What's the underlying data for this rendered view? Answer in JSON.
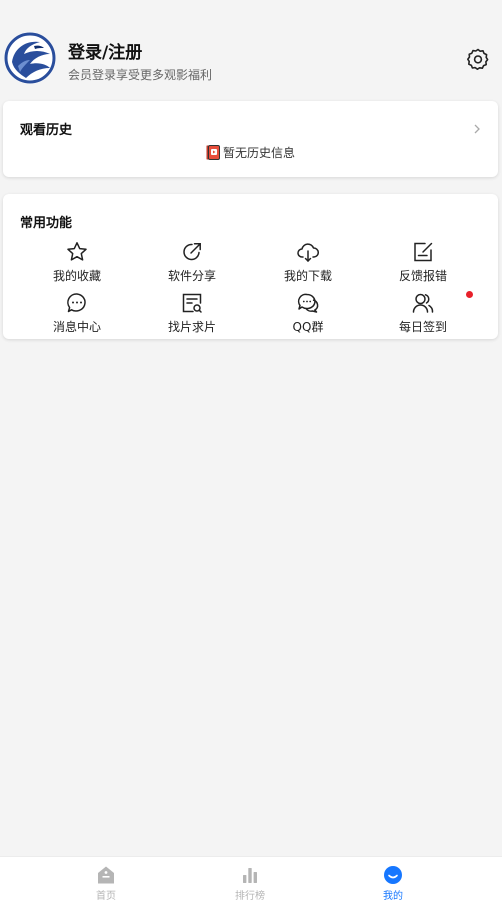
{
  "header": {
    "title": "登录/注册",
    "subtitle": "会员登录享受更多观影福利",
    "avatar_icon": "eagle-logo",
    "settings_icon": "gear-icon"
  },
  "history": {
    "title": "观看历史",
    "empty_text": "暂无历史信息",
    "empty_icon": "book-icon"
  },
  "functions": {
    "title": "常用功能",
    "items": [
      {
        "label": "我的收藏",
        "icon": "star-icon"
      },
      {
        "label": "软件分享",
        "icon": "share-icon"
      },
      {
        "label": "我的下载",
        "icon": "cloud-download-icon"
      },
      {
        "label": "反馈报错",
        "icon": "edit-icon"
      },
      {
        "label": "消息中心",
        "icon": "message-icon"
      },
      {
        "label": "找片求片",
        "icon": "search-doc-icon"
      },
      {
        "label": "QQ群",
        "icon": "chat-icon"
      },
      {
        "label": "每日签到",
        "icon": "users-icon"
      }
    ]
  },
  "tabbar": {
    "items": [
      {
        "label": "首页",
        "icon": "home-icon",
        "active": false
      },
      {
        "label": "排行榜",
        "icon": "chart-icon",
        "active": false
      },
      {
        "label": "我的",
        "icon": "profile-icon",
        "active": true
      }
    ]
  },
  "colors": {
    "accent": "#1677ff",
    "inactive_tab": "#b5b5b5",
    "badge": "#e8202a",
    "background": "#f4f4f4"
  }
}
